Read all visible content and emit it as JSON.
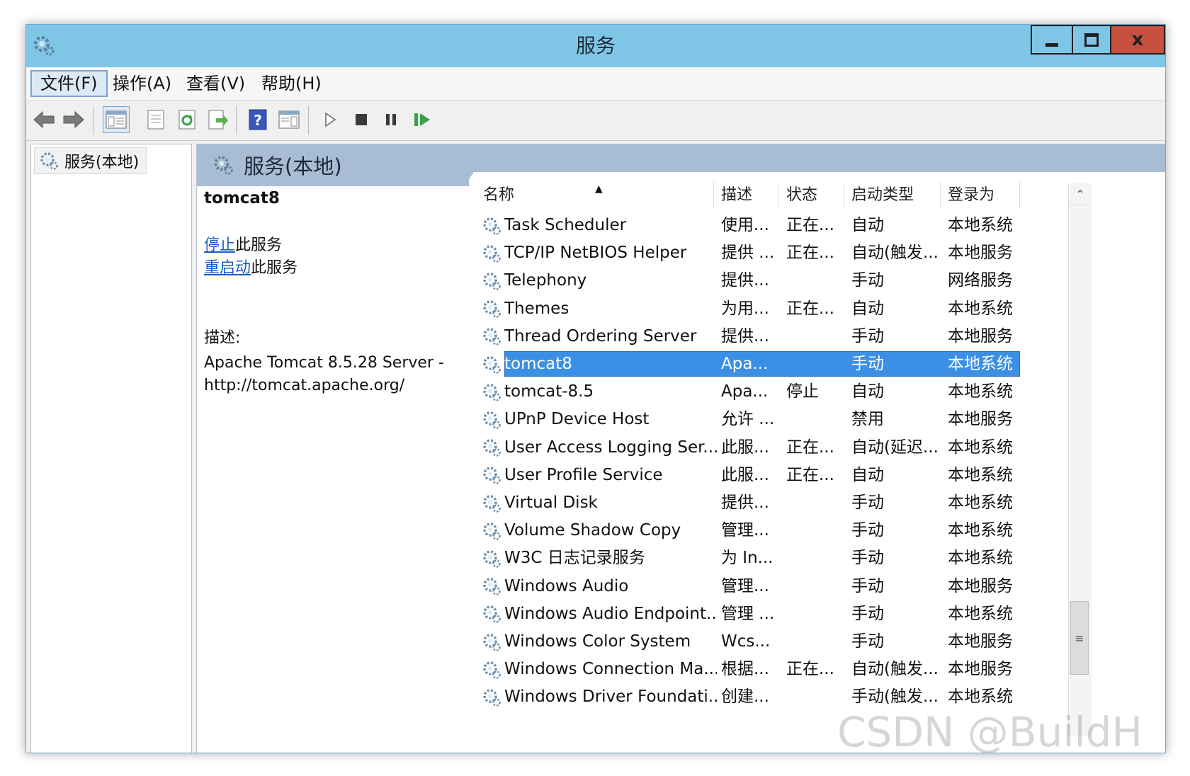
{
  "window": {
    "title": "服务",
    "close_glyph": "x"
  },
  "menubar": {
    "items": [
      "文件(F)",
      "操作(A)",
      "查看(V)",
      "帮助(H)"
    ]
  },
  "toolbar": {
    "icons": [
      "back-icon",
      "forward-icon",
      "show-console-tree-icon",
      "properties-icon",
      "refresh-icon",
      "export-list-icon",
      "help-icon",
      "show-hide-action-pane-icon",
      "start-service-icon",
      "stop-service-icon",
      "pause-service-icon",
      "restart-service-icon"
    ]
  },
  "tree": {
    "item": "服务(本地)"
  },
  "pane": {
    "header": "服务(本地)"
  },
  "details": {
    "service_name": "tomcat8",
    "stop_link": "停止",
    "stop_suffix": "此服务",
    "restart_link": "重启动",
    "restart_suffix": "此服务",
    "desc_label": "描述:",
    "desc_line1": "Apache Tomcat 8.5.28 Server -",
    "desc_line2": "http://tomcat.apache.org/"
  },
  "table": {
    "columns": [
      "名称",
      "描述",
      "状态",
      "启动类型",
      "登录为"
    ],
    "rows": [
      {
        "name": "Task Scheduler",
        "desc": "使用...",
        "status": "正在...",
        "startup": "自动",
        "logon": "本地系统"
      },
      {
        "name": "TCP/IP NetBIOS Helper",
        "desc": "提供 ...",
        "status": "正在...",
        "startup": "自动(触发...",
        "logon": "本地服务"
      },
      {
        "name": "Telephony",
        "desc": "提供...",
        "status": "",
        "startup": "手动",
        "logon": "网络服务"
      },
      {
        "name": "Themes",
        "desc": "为用...",
        "status": "正在...",
        "startup": "自动",
        "logon": "本地系统"
      },
      {
        "name": "Thread Ordering Server",
        "desc": "提供...",
        "status": "",
        "startup": "手动",
        "logon": "本地服务"
      },
      {
        "name": "tomcat8",
        "desc": "Apa...",
        "status": "",
        "startup": "手动",
        "logon": "本地系统",
        "selected": true
      },
      {
        "name": "tomcat-8.5",
        "desc": "Apa...",
        "status": "停止",
        "startup": "自动",
        "logon": "本地系统"
      },
      {
        "name": "UPnP Device Host",
        "desc": "允许 ...",
        "status": "",
        "startup": "禁用",
        "logon": "本地服务"
      },
      {
        "name": "User Access Logging Ser...",
        "desc": "此服...",
        "status": "正在...",
        "startup": "自动(延迟...",
        "logon": "本地系统"
      },
      {
        "name": "User Profile Service",
        "desc": "此服...",
        "status": "正在...",
        "startup": "自动",
        "logon": "本地系统"
      },
      {
        "name": "Virtual Disk",
        "desc": "提供...",
        "status": "",
        "startup": "手动",
        "logon": "本地系统"
      },
      {
        "name": "Volume Shadow Copy",
        "desc": "管理...",
        "status": "",
        "startup": "手动",
        "logon": "本地系统"
      },
      {
        "name": "W3C 日志记录服务",
        "desc": "为 In...",
        "status": "",
        "startup": "手动",
        "logon": "本地系统"
      },
      {
        "name": "Windows Audio",
        "desc": "管理...",
        "status": "",
        "startup": "手动",
        "logon": "本地服务"
      },
      {
        "name": "Windows Audio Endpoint...",
        "desc": "管理 ...",
        "status": "",
        "startup": "手动",
        "logon": "本地系统"
      },
      {
        "name": "Windows Color System",
        "desc": "Wcs...",
        "status": "",
        "startup": "手动",
        "logon": "本地服务"
      },
      {
        "name": "Windows Connection Ma...",
        "desc": "根据...",
        "status": "正在...",
        "startup": "自动(触发...",
        "logon": "本地服务"
      },
      {
        "name": "Windows Driver Foundati...",
        "desc": "创建...",
        "status": "",
        "startup": "手动(触发...",
        "logon": "本地系统"
      }
    ]
  },
  "scrollbar": {
    "up_glyph": "⌃",
    "thumb_glyph": "≡"
  },
  "watermark": "CSDN @BuildH",
  "colors": {
    "titlebar": "#7fc6e6",
    "selection": "#3b8fe5",
    "link": "#1a5cc0",
    "close_button": "#c7503f",
    "pane_header": "#a8bdd4"
  }
}
